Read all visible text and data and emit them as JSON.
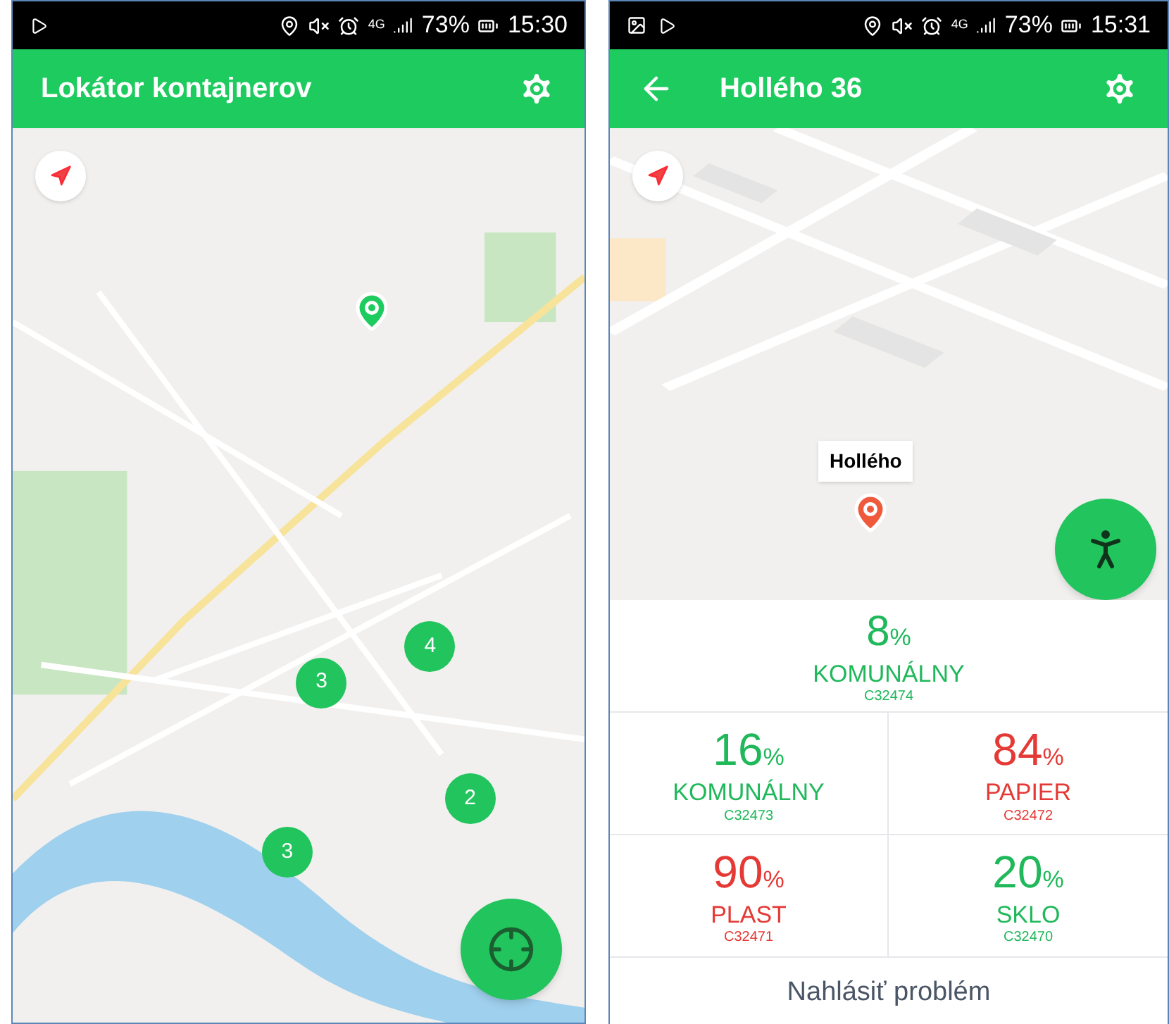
{
  "screens": [
    {
      "status_bar": {
        "network": "4G",
        "battery": "73%",
        "time": "15:30"
      },
      "app_bar": {
        "title": "Lokátor kontajnerov",
        "back": false
      },
      "map": {
        "kind": "overview",
        "clusters": [
          {
            "count": "3"
          },
          {
            "count": "4"
          },
          {
            "count": "2"
          },
          {
            "count": "3"
          }
        ]
      }
    },
    {
      "status_bar": {
        "network": "4G",
        "battery": "73%",
        "time": "15:31"
      },
      "app_bar": {
        "title": "Hollého 36",
        "back": true
      },
      "map": {
        "kind": "detail",
        "callout": "Hollého"
      },
      "containers": [
        {
          "percent": "8",
          "unit": "%",
          "type": "KOMUNÁLNY",
          "code": "C32474",
          "color": "#1fb85a"
        },
        {
          "percent": "16",
          "unit": "%",
          "type": "KOMUNÁLNY",
          "code": "C32473",
          "color": "#1fb85a"
        },
        {
          "percent": "84",
          "unit": "%",
          "type": "PAPIER",
          "code": "C32472",
          "color": "#e53935"
        },
        {
          "percent": "90",
          "unit": "%",
          "type": "PLAST",
          "code": "C32471",
          "color": "#e53935"
        },
        {
          "percent": "20",
          "unit": "%",
          "type": "SKLO",
          "code": "C32470",
          "color": "#1fb85a"
        }
      ],
      "report_button": "Nahlásiť problém"
    }
  ]
}
